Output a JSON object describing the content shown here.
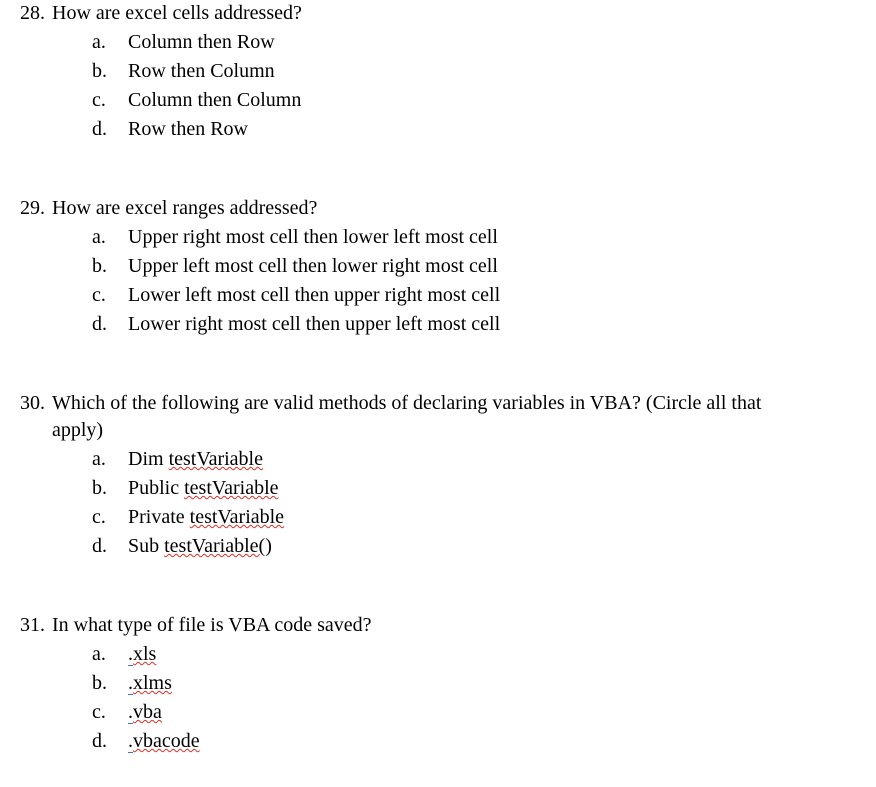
{
  "questions": [
    {
      "num": "28.",
      "text": "How are excel cells addressed?",
      "options": [
        {
          "m": "a.",
          "plain": "Column then Row"
        },
        {
          "m": "b.",
          "plain": "Row then Column"
        },
        {
          "m": "c.",
          "plain": "Column then Column"
        },
        {
          "m": "d.",
          "plain": "Row then Row"
        }
      ]
    },
    {
      "num": "29.",
      "text": "How are excel ranges addressed?",
      "options": [
        {
          "m": "a.",
          "plain": "Upper right most cell then lower left most cell"
        },
        {
          "m": "b.",
          "plain": "Upper left most cell then lower right most cell"
        },
        {
          "m": "c.",
          "plain": "Lower left most cell then upper right most cell"
        },
        {
          "m": "d.",
          "plain": "Lower right most cell then upper left most cell"
        }
      ]
    },
    {
      "num": "30.",
      "text": "Which of the following are valid methods of declaring variables in VBA? (Circle all that",
      "text2": "apply)",
      "options": [
        {
          "m": "a.",
          "pre": "Dim ",
          "sq": "testVariable"
        },
        {
          "m": "b.",
          "pre": "Public ",
          "sq": "testVariable"
        },
        {
          "m": "c.",
          "pre": "Private ",
          "sq": "testVariable"
        },
        {
          "m": "d.",
          "pre": "Sub ",
          "sq": "testVariable(",
          "post": ")"
        }
      ]
    },
    {
      "num": "31.",
      "text": "In what type of file is VBA code saved?",
      "options": [
        {
          "m": "a.",
          "dot": ".",
          "sq": "xls"
        },
        {
          "m": "b.",
          "dot": ".",
          "sq": "xlms"
        },
        {
          "m": "c.",
          "dot": ".",
          "sq": "vba"
        },
        {
          "m": "d.",
          "dot": ".",
          "sq": "vbacode"
        }
      ]
    }
  ]
}
